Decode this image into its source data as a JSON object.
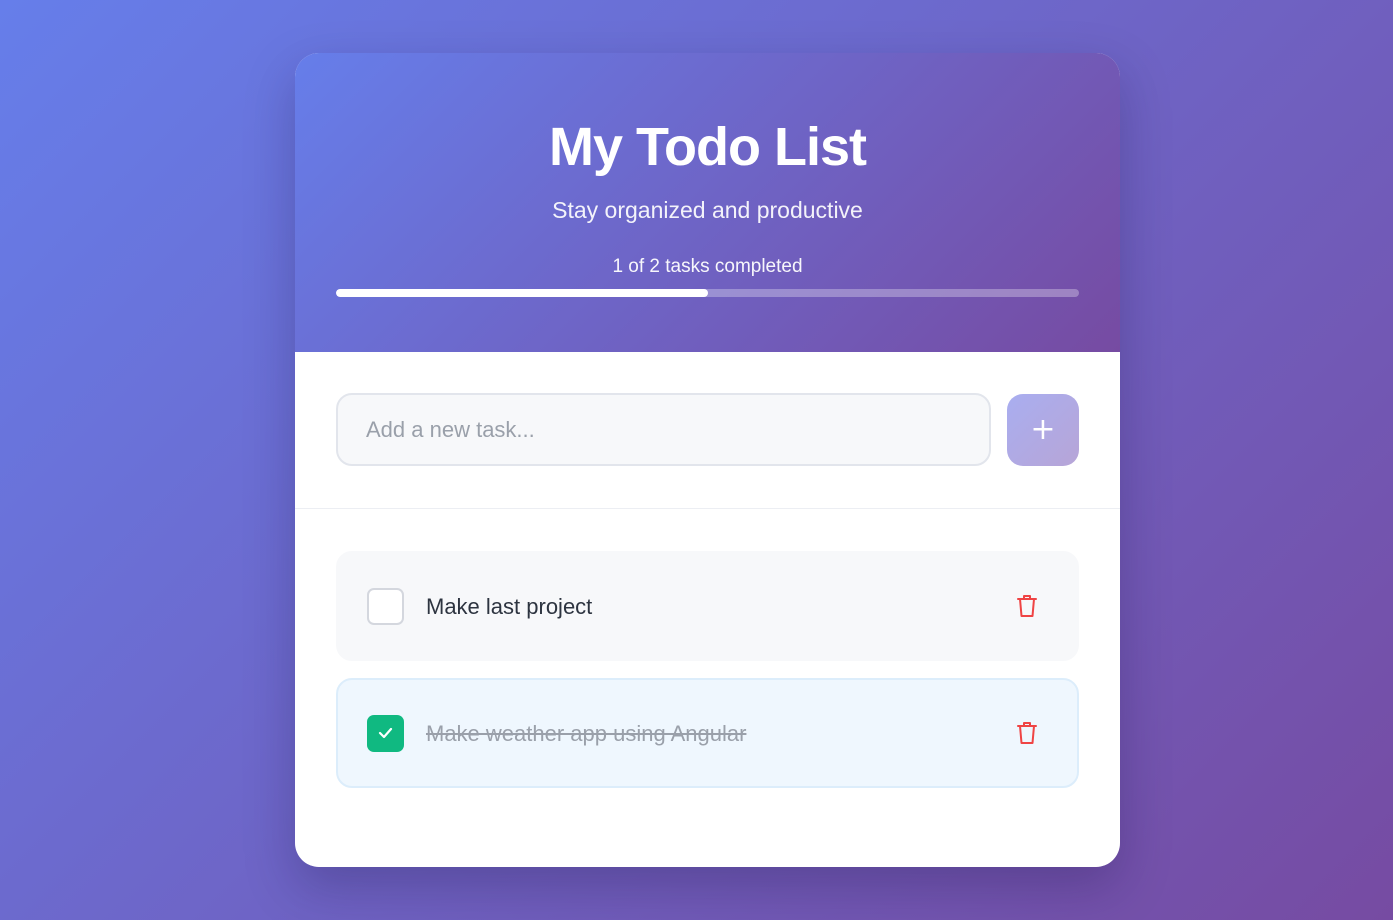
{
  "header": {
    "title": "My Todo List",
    "subtitle": "Stay organized and productive",
    "progress_text": "1 of 2 tasks completed",
    "progress_fraction": 0.5
  },
  "add_task": {
    "placeholder": "Add a new task...",
    "value": "",
    "button_label": "+"
  },
  "todos": [
    {
      "text": "Make last project",
      "completed": false,
      "checkbox_icon": "empty-checkbox",
      "delete_icon": "trash-icon"
    },
    {
      "text": "Make weather app using Angular",
      "completed": true,
      "checkbox_icon": "checkmark-icon",
      "delete_icon": "trash-icon"
    }
  ],
  "colors": {
    "gradient_start": "#667eea",
    "gradient_end": "#764ba2",
    "checked": "#10b981",
    "delete": "#ef4444",
    "completed_item_bg": "#eff7fe"
  }
}
